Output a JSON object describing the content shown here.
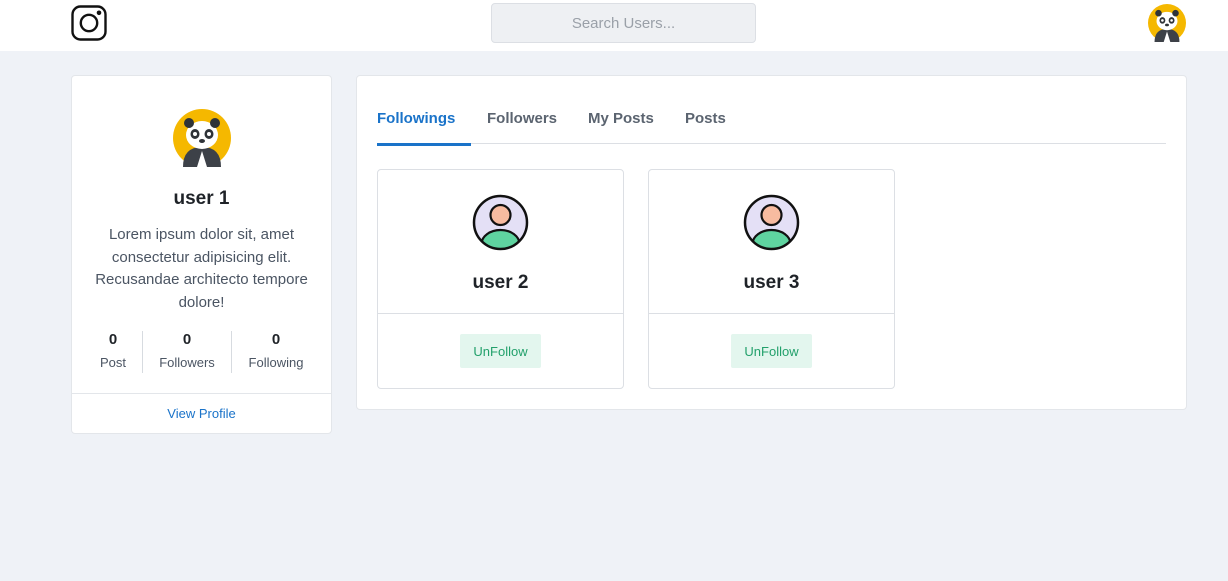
{
  "header": {
    "logo_icon": "instagram-icon",
    "search_placeholder": "Search Users...",
    "avatar_icon": "panda-avatar-icon"
  },
  "profile": {
    "avatar_icon": "panda-avatar-icon",
    "name": "user 1",
    "bio": "Lorem ipsum dolor sit, amet consectetur adipisicing elit. Recusandae architecto tempore dolore!",
    "stats": [
      {
        "value": "0",
        "label": "Post"
      },
      {
        "value": "0",
        "label": "Followers"
      },
      {
        "value": "0",
        "label": "Following"
      }
    ],
    "view_profile_label": "View Profile"
  },
  "tabs": [
    {
      "label": "Followings",
      "active": true
    },
    {
      "label": "Followers",
      "active": false
    },
    {
      "label": "My Posts",
      "active": false
    },
    {
      "label": "Posts",
      "active": false
    }
  ],
  "users": [
    {
      "name": "user 2",
      "button_label": "UnFollow",
      "icon": "user-placeholder-icon"
    },
    {
      "name": "user 3",
      "button_label": "UnFollow",
      "icon": "user-placeholder-icon"
    }
  ],
  "colors": {
    "accent": "#1a73c9",
    "background": "#eff2f7",
    "unfollow_bg": "#e3f6ee",
    "unfollow_text": "#22a06b",
    "avatar_yellow": "#f5b800"
  }
}
